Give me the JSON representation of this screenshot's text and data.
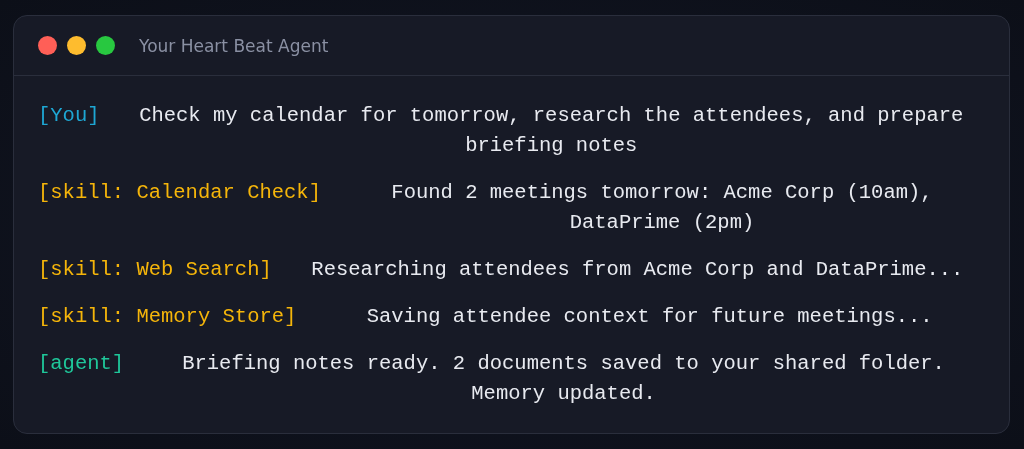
{
  "window": {
    "title": "Your Heart Beat Agent"
  },
  "messages": [
    {
      "kind": "user",
      "label": "[You]",
      "text": "Check my calendar for tomorrow, research the attendees, and prepare briefing notes"
    },
    {
      "kind": "skill",
      "label": "[skill: Calendar Check]",
      "text": "Found 2 meetings tomorrow: Acme Corp (10am), DataPrime (2pm)"
    },
    {
      "kind": "skill",
      "label": "[skill: Web Search]",
      "text": "Researching attendees from Acme Corp and DataPrime..."
    },
    {
      "kind": "skill",
      "label": "[skill: Memory Store]",
      "text": "Saving attendee context for future meetings..."
    },
    {
      "kind": "agent",
      "label": "[agent]",
      "text": "Briefing notes ready. 2 documents saved to your shared folder. Memory updated."
    }
  ]
}
